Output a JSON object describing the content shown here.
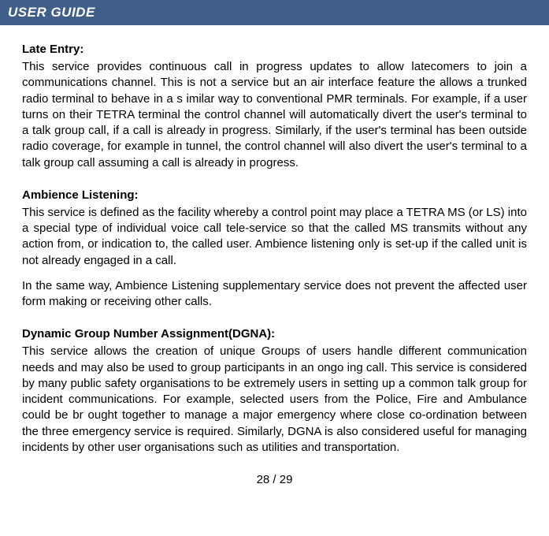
{
  "header": {
    "title": "USER GUIDE"
  },
  "sections": [
    {
      "title": "Late Entry:",
      "paragraphs": [
        "This service provides continuous call in progress updates to allow latecomers to join a communications channel. This is not a service but an air interface feature the allows a trunked radio terminal to behave in a s imilar way to conventional PMR terminals. For example, if a user turns on their TETRA terminal the control channel will automatically divert the user's terminal to a talk group call, if a call is already in progress. Similarly, if the user's terminal has been outside radio coverage, for example in tunnel, the control channel will also divert the user's terminal to a talk group call assuming a call is already in progress."
      ]
    },
    {
      "title": "Ambience Listening:",
      "paragraphs": [
        "This service is defined as the facility whereby a control point may place a TETRA MS (or LS) into a special type of individual voice call tele-service so that the called MS transmits without any action from, or indication to, the called user. Ambience listening only is set-up if the called unit is not already engaged in a call.",
        "In the same way, Ambience Listening supplementary service does not prevent the affected user form making or receiving other calls."
      ]
    },
    {
      "title": "Dynamic Group Number Assignment(DGNA):",
      "paragraphs": [
        "This service allows the creation of unique Groups of users handle different communication needs and may also be used to group participants in an ongo ing call. This service is considered by many public safety organisations to be extremely users in setting up a common talk group for incident communications. For example, selected users from the Police, Fire and Ambulance could be br ought together to manage a major emergency where close co-ordination between the three emergency service is required. Similarly, DGNA is also considered useful for managing incidents by other user organisations such as utilities and transportation."
      ]
    }
  ],
  "pageNumber": "28 / 29"
}
